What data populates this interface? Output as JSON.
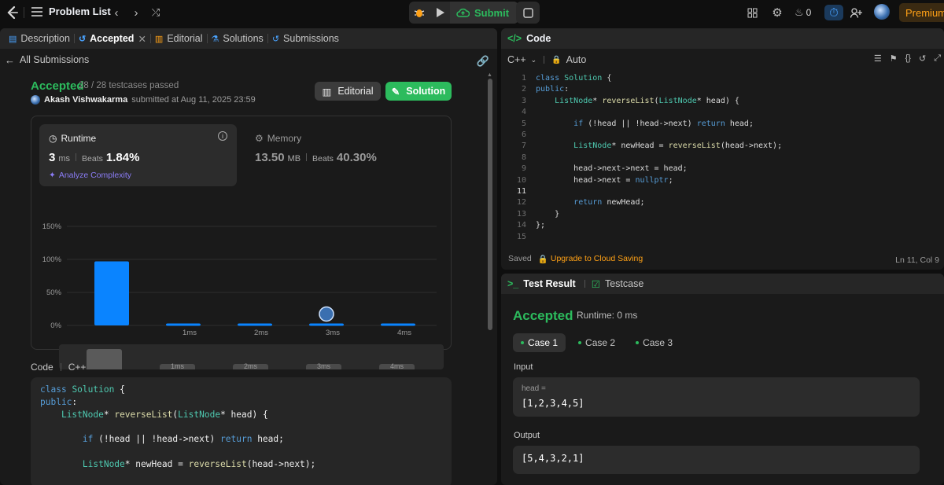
{
  "topbar": {
    "problem_list": "Problem List",
    "submit_label": "Submit",
    "streak_count": "0",
    "premium_label": "Premium"
  },
  "left_tabs": [
    {
      "label": "Description"
    },
    {
      "label": "Accepted"
    },
    {
      "label": "Editorial"
    },
    {
      "label": "Solutions"
    },
    {
      "label": "Submissions"
    }
  ],
  "submission": {
    "back_label": "All Submissions",
    "status": "Accepted",
    "testcases": "28 / 28 testcases passed",
    "author": "Akash Vishwakarma",
    "submitted_text": "submitted at Aug 11, 2025 23:59",
    "editorial_btn": "Editorial",
    "solution_btn": "Solution"
  },
  "runtime": {
    "title": "Runtime",
    "value": "3",
    "unit": "ms",
    "beats_label": "Beats",
    "beats": "1.84%",
    "analyze": "Analyze Complexity"
  },
  "memory": {
    "title": "Memory",
    "value": "13.50",
    "unit": "MB",
    "beats_label": "Beats",
    "beats": "40.30%"
  },
  "chart_data": {
    "type": "bar",
    "categories": [
      "",
      "1ms",
      "2ms",
      "3ms",
      "4ms"
    ],
    "values": [
      97,
      3,
      3,
      3,
      3
    ],
    "ylim": [
      0,
      150
    ],
    "yticks": [
      "150%",
      "100%",
      "50%",
      "0%"
    ],
    "highlight_index": 3,
    "grid": true,
    "colors": {
      "bar": "#0a84ff"
    }
  },
  "scrubber_labels": [
    "1ms",
    "2ms",
    "3ms",
    "4ms"
  ],
  "code_section": {
    "label": "Code",
    "lang": "C++",
    "lines": [
      "class Solution {",
      "public:",
      "    ListNode* reverseList(ListNode* head) {",
      "",
      "        if (!head || !head->next) return head;",
      "",
      "        ListNode* newHead = reverseList(head->next);"
    ]
  },
  "editor": {
    "title": "Code",
    "language": "C++",
    "mode": "Auto",
    "line_numbers": [
      "1",
      "2",
      "3",
      "4",
      "5",
      "6",
      "7",
      "8",
      "9",
      "10",
      "11",
      "12",
      "13",
      "14",
      "15"
    ],
    "lines": [
      "class Solution {",
      "public:",
      "    ListNode* reverseList(ListNode* head) {",
      "",
      "        if (!head || !head->next) return head;",
      "",
      "        ListNode* newHead = reverseList(head->next);",
      "",
      "        head->next->next = head;",
      "        head->next = nullptr;",
      "",
      "        return newHead;",
      "    }",
      "};",
      ""
    ],
    "saved": "Saved",
    "upgrade": "Upgrade to Cloud Saving",
    "cursor": "Ln 11, Col 9"
  },
  "test_result": {
    "tab_result": "Test Result",
    "tab_testcase": "Testcase",
    "status": "Accepted",
    "runtime": "Runtime: 0 ms",
    "cases": [
      "Case 1",
      "Case 2",
      "Case 3"
    ],
    "input_label": "Input",
    "param_name": "head =",
    "input_value": "[1,2,3,4,5]",
    "output_label": "Output",
    "output_value": "[5,4,3,2,1]"
  },
  "colors": {
    "accent_green": "#2cbb5d",
    "accent_orange": "#ffa116",
    "bar_blue": "#0a84ff",
    "purple": "#8b7cf6"
  }
}
